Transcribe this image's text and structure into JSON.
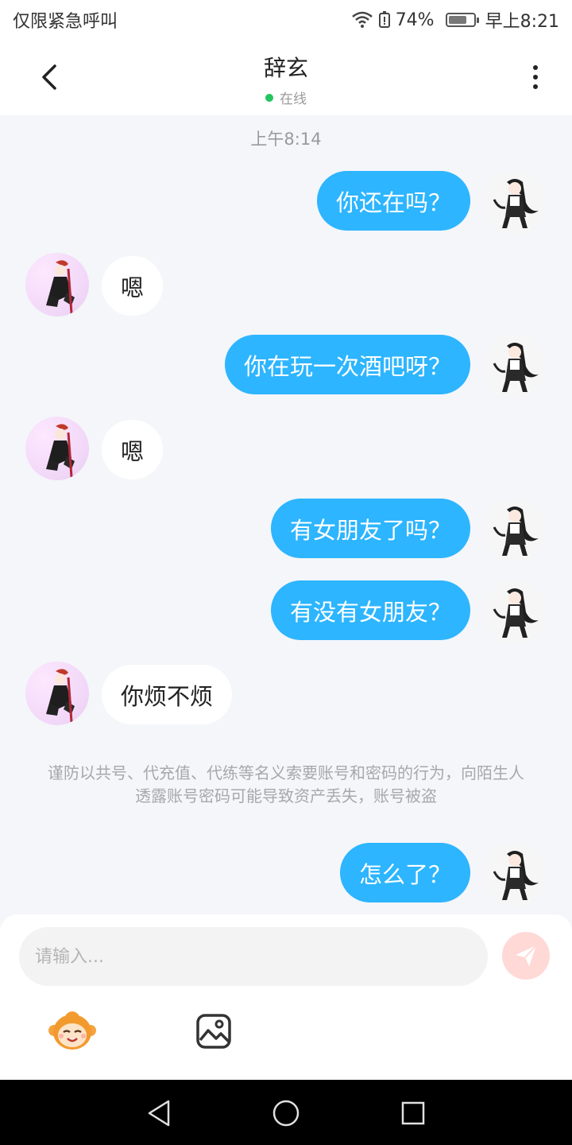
{
  "status_bar": {
    "carrier_text": "仅限紧急呼叫",
    "battery": "74%",
    "battery_level": 0.74,
    "time": "早上8:21"
  },
  "header": {
    "title": "辞玄",
    "presence": "在线"
  },
  "chat": {
    "timestamp": "上午8:14",
    "messages": [
      {
        "from": "self",
        "text": "你还在吗？"
      },
      {
        "from": "peer",
        "text": "嗯"
      },
      {
        "from": "self",
        "text": "你在玩一次酒吧呀？"
      },
      {
        "from": "peer",
        "text": "嗯"
      },
      {
        "from": "self",
        "text": "有女朋友了吗？"
      },
      {
        "from": "self",
        "text": "有没有女朋友？"
      },
      {
        "from": "peer",
        "text": "你烦不烦"
      },
      {
        "from": "self",
        "text": "怎么了？"
      }
    ],
    "notice": "谨防以共号、代充值、代练等名义索要账号和密码的行为，向陌生人透露账号密码可能导致资产丢失，账号被盗"
  },
  "composer": {
    "placeholder": "请输入..."
  },
  "icons": {
    "back": "chevron-left-icon",
    "more": "more-vertical-icon",
    "send": "paper-plane-icon",
    "emoji": "monkey-emoji-icon",
    "image": "image-icon",
    "nav_back": "triangle-back-icon",
    "nav_home": "circle-home-icon",
    "nav_recent": "square-recent-icon"
  },
  "colors": {
    "outgoing_bubble": "#2db5ff",
    "incoming_bubble": "#ffffff",
    "online_dot": "#22c55e",
    "send_button": "#ffd9d6"
  }
}
